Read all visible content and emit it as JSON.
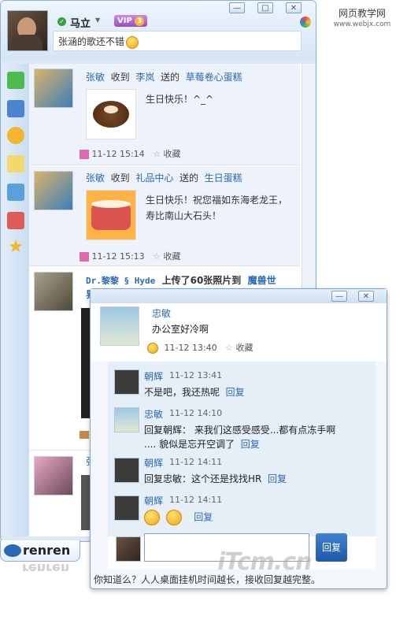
{
  "watermark": {
    "top": "网页教学网",
    "bottom": "www.webjx.com"
  },
  "header": {
    "user_name": "马立",
    "vip_label": "VIP",
    "vip_level": "3",
    "status_text": "张涵的歌还不错",
    "minimize": "—",
    "maximize": "□",
    "close": "✕"
  },
  "feed": [
    {
      "actor": "张敏",
      "verb1": "收到",
      "from": "李岚",
      "verb2": "送的",
      "gift": "草莓卷心蛋糕",
      "message": "生日快乐！^_^",
      "time": "11-12 15:14",
      "fav": "收藏"
    },
    {
      "actor": "张敏",
      "verb1": "收到",
      "from": "礼品中心",
      "verb2": "送的",
      "gift": "生日蛋糕",
      "message_line1": "生日快乐！祝您福如东海老龙王，",
      "message_line2": "寿比南山大石头！",
      "time": "11-12 15:13",
      "fav": "收藏"
    },
    {
      "actor": "Dr.黎黎 § Hyde",
      "verb": "上传了60张照片到",
      "album": "魔兽世",
      "album_cont": "界"
    },
    {
      "actor": "张"
    }
  ],
  "brand": {
    "logo": "renren",
    "reflection": "renren"
  },
  "popup": {
    "minimize": "—",
    "close": "✕",
    "post": {
      "author": "忠敏",
      "text": "办公室好冷啊",
      "time": "11-12 13:40",
      "fav": "收藏"
    },
    "comments": [
      {
        "name": "朝辉",
        "time": "11-12 13:41",
        "text": "不是吧，我还热呢",
        "reply": "回复"
      },
      {
        "name": "忠敏",
        "time": "11-12 14:10",
        "text_line1": "回复朝辉： 来我们这感受感受...都有点冻手啊",
        "text_line2": ".... 貌似是忘开空调了",
        "reply": "回复"
      },
      {
        "name": "朝辉",
        "time": "11-12 14:11",
        "text": "回复忠敏：这个还是找找HR",
        "reply": "回复"
      },
      {
        "name": "朝辉",
        "time": "11-12 14:11",
        "reply": "回复"
      }
    ],
    "reply_button": "回复",
    "reply_input_value": "",
    "tip": "你知道么？人人桌面挂机时间越长，接收回复越完整。"
  },
  "site_watermark": "iTcm.cn",
  "colors": {
    "accent": "#2a6ab5",
    "frame": "#8fb0d8"
  }
}
